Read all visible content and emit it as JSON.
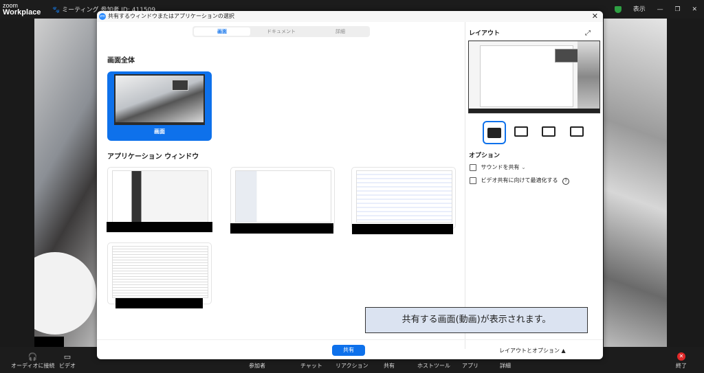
{
  "app": {
    "logo_line1": "zoom",
    "logo_line2": "Workplace"
  },
  "meeting": {
    "label": "ミーティング 参加者 ID: 411509"
  },
  "window": {
    "view_label": "表示"
  },
  "dialog": {
    "title": "共有するウィンドウまたはアプリケーションの選択",
    "tabs": [
      "画面",
      "ドキュメント",
      "詳細"
    ],
    "section_screen": "画面全体",
    "screen_label": "画面",
    "section_apps": "アプリケーション ウィンドウ",
    "layout_title": "レイアウト",
    "options_title": "オプション",
    "option_sound": "サウンドを共有",
    "option_video": "ビデオ共有に向けて最適化する",
    "share_button": "共有",
    "layout_options": "レイアウトとオプション"
  },
  "bottombar": {
    "audio": "オーディオに接続",
    "video": "ビデオ",
    "participants": "参加者",
    "chat": "チャット",
    "reactions": "リアクション",
    "share": "共有",
    "host_tools": "ホストツール",
    "apps": "アプリ",
    "details": "詳細",
    "end": "終了"
  },
  "caption": "共有する画面(動画)が表示されます。",
  "colors": {
    "accent": "#0e71eb",
    "end": "#e02828"
  }
}
